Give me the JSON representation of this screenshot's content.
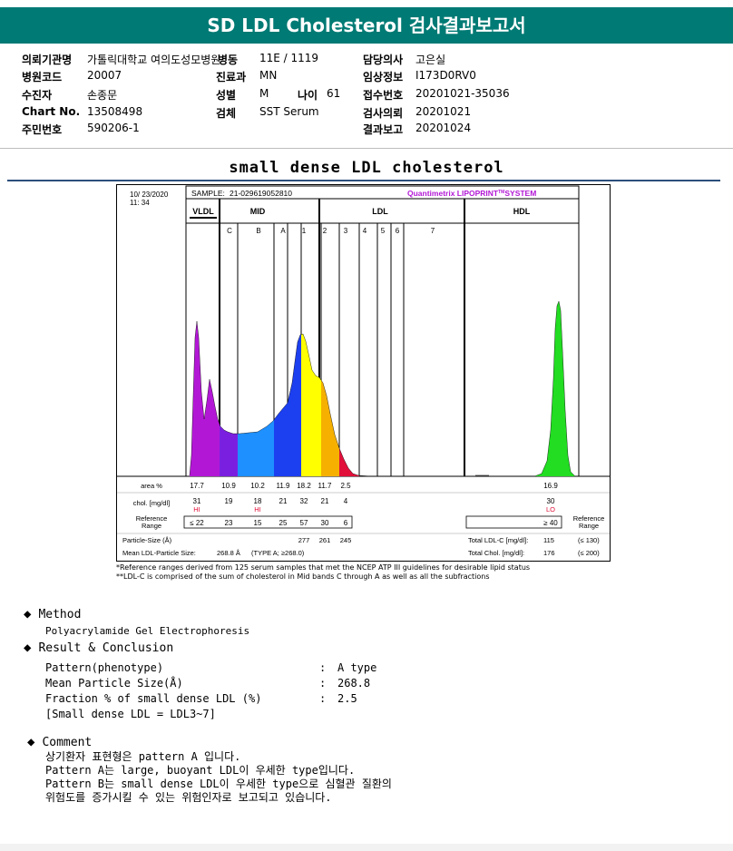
{
  "title": "SD LDL Cholesterol 검사결과보고서",
  "header": {
    "col1": [
      {
        "label": "의뢰기관명",
        "value": "가톨릭대학교 여의도성모병원"
      },
      {
        "label": "병원코드",
        "value": "20007"
      },
      {
        "label": "수진자",
        "value": "손종문"
      },
      {
        "label": "Chart No.",
        "value": "13508498"
      },
      {
        "label": "주민번호",
        "value": "590206-1"
      }
    ],
    "ward_label": "병동",
    "ward_value": "11E / 1119",
    "dept_label": "진료과",
    "dept_value": "MN",
    "sex_label": "성별",
    "sex_value": "M",
    "age_label": "나이",
    "age_value": "61",
    "specimen_label": "검체",
    "specimen_value": "SST Serum",
    "col3": [
      {
        "label": "담당의사",
        "value": "고은실"
      },
      {
        "label": "임상정보",
        "value": "I173D0RV0"
      },
      {
        "label": "접수번호",
        "value": "20201021-35036"
      },
      {
        "label": "검사의뢰",
        "value": "20201021"
      },
      {
        "label": "결과보고",
        "value": "20201024"
      }
    ]
  },
  "subtitle": "small dense LDL cholesterol",
  "report": {
    "date": "10/ 23/2020",
    "time": "11: 34",
    "sample_label": "SAMPLE:",
    "sample_id": "21-029619052810",
    "brand": "Quantimetrix LIPOPRINT",
    "brand_tm": "TM",
    "brand_tail": "SYSTEM",
    "groups": [
      "VLDL",
      "MID",
      "LDL",
      "HDL"
    ],
    "bands": [
      "C",
      "B",
      "A",
      "1",
      "2",
      "3",
      "4",
      "5",
      "6",
      "7"
    ],
    "area_label": "area %",
    "area_values": [
      "17.7",
      "10.9",
      "10.2",
      "11.9",
      "18.2",
      "11.7",
      "2.5"
    ],
    "hdl_area": "16.9",
    "chol_label": "chol. [mg/dl]",
    "chol_values": [
      "31",
      "19",
      "18",
      "21",
      "32",
      "21",
      "4"
    ],
    "hdl_chol": "30",
    "flags": [
      "HI",
      "",
      "HI",
      "",
      "",
      "",
      ""
    ],
    "hdl_flag": "LO",
    "ref_label_1": "Reference",
    "ref_label_2": "Range",
    "ref_values": [
      "≤ 22",
      "23",
      "15",
      "25",
      "57",
      "30",
      "6"
    ],
    "hdl_ref": "≥ 40",
    "particle_label": "Particle-Size (Å)",
    "particle_values": [
      "277",
      "261",
      "245"
    ],
    "mean_label": "Mean LDL-Particle Size:",
    "mean_value": "268.8 Å",
    "mean_type": "(TYPE A; ≥268.0)",
    "total_ldl_label": "Total LDL-C [mg/dl]:",
    "total_ldl_value": "115",
    "total_ldl_ref": "(≤ 130)",
    "total_chol_label": "Total Chol. [mg/dl]:",
    "total_chol_value": "176",
    "total_chol_ref": "(≤ 200)",
    "colors": {
      "vldl": "#b317d6",
      "midc": "#7a1fe0",
      "midb": "#1e90ff",
      "mida": "#1c3ff0",
      "ldl1": "#ffff00",
      "ldl2": "#f5b000",
      "ldl3": "#e0103a",
      "hdl": "#22dd22"
    }
  },
  "notes": {
    "line1": "*Reference ranges derived from 125 serum samples that met the NCEP ATP III guidelines for desirable lipid status",
    "line2": "**LDL-C is comprised of the sum of cholesterol in Mid bands C through A as well as all the subfractions"
  },
  "method": {
    "title": "Method",
    "text": "Polyacrylamide Gel Electrophoresis"
  },
  "result": {
    "title": "Result & Conclusion",
    "rows": [
      {
        "label": "Pattern(phenotype)",
        "value": "A type"
      },
      {
        "label": "Mean Particle Size(Å)",
        "value": "268.8"
      },
      {
        "label": "Fraction % of small dense LDL (%)",
        "value": "2.5"
      }
    ],
    "bracket": "[Small dense LDL = LDL3~7]",
    "sep": ":"
  },
  "comment": {
    "title": "Comment",
    "lines": [
      "상기환자 표현형은 pattern A 입니다.",
      "Pattern A는 large, buoyant LDL이 우세한 type입니다.",
      "Pattern B는 small dense LDL이 우세한 type으로 심혈관 질환의",
      "위험도를 증가시킬 수 있는 위험인자로 보고되고 있습니다."
    ]
  },
  "icons": {
    "section_marker": "diamond-icon"
  }
}
